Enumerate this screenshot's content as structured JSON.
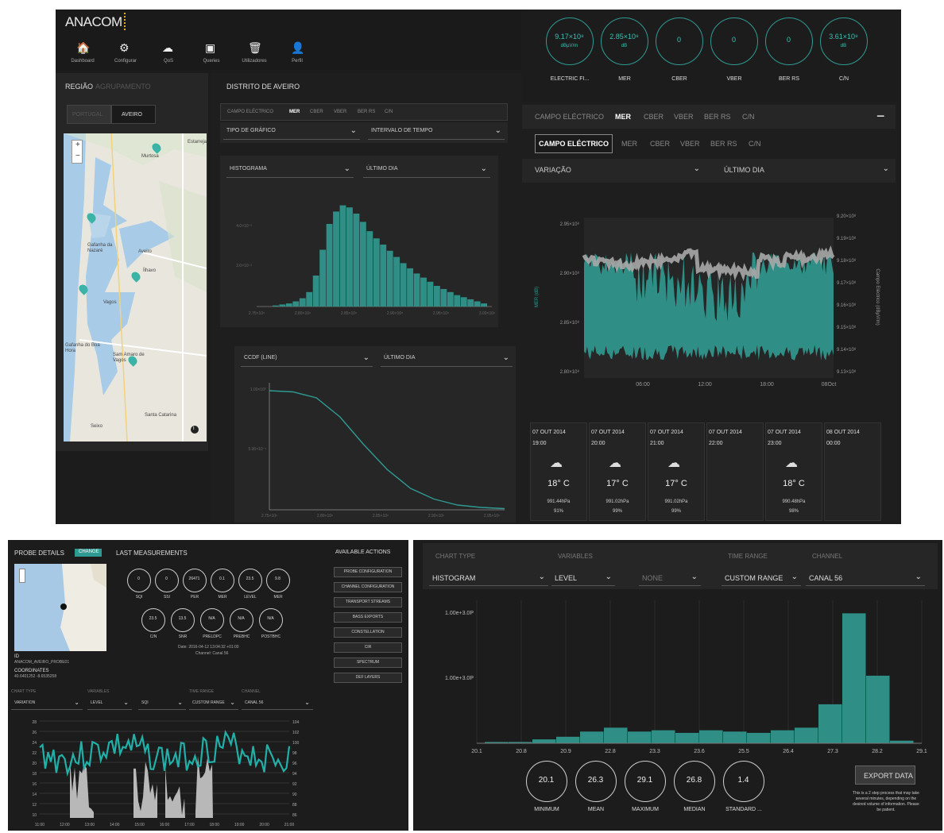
{
  "brand": "ANACOM",
  "nav": [
    "Dashboard",
    "Configurar",
    "QoS",
    "Queries",
    "Utilizadores",
    "Perfil"
  ],
  "left": {
    "region_label": "REGIÃO",
    "region_muted": "AGRUPAMENTO",
    "tab_portugal": "PORTUGAL",
    "tab_aveiro": "AVEIRO",
    "map_places": [
      "Estarreja",
      "Murtosa",
      "Gafanha da Nazaré",
      "Aveiro",
      "Ílhavo",
      "Vagos",
      "Santa Catarina",
      "Seixo",
      "Gafanha do Boa Hora",
      "Sam Amaro de Vagos"
    ],
    "zoom_in": "+",
    "zoom_out": "−",
    "info": "i"
  },
  "mid": {
    "title": "DISTRITO DE AVEIRO",
    "tabs": [
      "CAMPO ELÉCTRICO",
      "MER",
      "CBER",
      "VBER",
      "BER RS",
      "C/N"
    ],
    "dd1": "TIPO DE GRÁFICO",
    "dd2": "INTERVALO DE TEMPO",
    "dd3": "HISTOGRAMA",
    "dd4": "ÚLTIMO DIA",
    "dd5": "CCDF (LINE)",
    "dd6": "ÚLTIMO DIA"
  },
  "gauges": [
    {
      "value": "9.17×10⁸",
      "unit": "dBµV/m",
      "label": "ELECTRIC FI..."
    },
    {
      "value": "2.85×10⁸",
      "unit": "dB",
      "label": "MER"
    },
    {
      "value": "0",
      "unit": "",
      "label": "CBER"
    },
    {
      "value": "0",
      "unit": "",
      "label": "VBER"
    },
    {
      "value": "0",
      "unit": "",
      "label": "BER RS"
    },
    {
      "value": "3.61×10⁸",
      "unit": "dB",
      "label": "C/N"
    }
  ],
  "right": {
    "tabs1": [
      "CAMPO ELÉCTRICO",
      "MER",
      "CBER",
      "VBER",
      "BER RS",
      "C/N"
    ],
    "minus": "−",
    "tabs2": [
      "CAMPO ELÉCTRICO",
      "MER",
      "CBER",
      "VBER",
      "BER RS",
      "C/N"
    ],
    "dd1": "VARIAÇÃO",
    "dd2": "ÚLTIMO DIA",
    "y_left": [
      "2.95×10⁸",
      "2.90×10⁸",
      "2.85×10⁸",
      "2.80×10⁸"
    ],
    "y_right": [
      "9.20×10⁸",
      "9.19×10⁸",
      "9.18×10⁸",
      "9.17×10⁸",
      "9.16×10⁸",
      "9.15×10⁸",
      "9.14×10⁸",
      "9.13×10⁸"
    ],
    "x": [
      "06:00",
      "12:00",
      "18:00",
      "08Oct"
    ],
    "y_left_label": "MER (dB)",
    "y_right_label": "Campo Eléctrico (dBµV/m)"
  },
  "weather": [
    {
      "date": "07 OUT 2014",
      "time": "19:00",
      "temp": "18° C",
      "press": "991.44hPa",
      "hum": "91%"
    },
    {
      "date": "07 OUT 2014",
      "time": "20:00",
      "temp": "17° C",
      "press": "991.02hPa",
      "hum": "99%"
    },
    {
      "date": "07 OUT 2014",
      "time": "21:00",
      "temp": "17° C",
      "press": "991.02hPa",
      "hum": "99%"
    },
    {
      "date": "07 OUT 2014",
      "time": "22:00",
      "temp": "",
      "press": "",
      "hum": ""
    },
    {
      "date": "07 OUT 2014",
      "time": "23:00",
      "temp": "18° C",
      "press": "990.48hPa",
      "hum": "98%"
    },
    {
      "date": "08 OUT 2014",
      "time": "00:00",
      "temp": "",
      "press": "",
      "hum": ""
    }
  ],
  "probe": {
    "title": "PROBE DETAILS",
    "change": "CHANGE",
    "last": "LAST MEASUREMENTS",
    "actions_title": "AVAILABLE ACTIONS",
    "meas_row1": [
      {
        "v": "0",
        "l": "SQI"
      },
      {
        "v": "0",
        "l": "SSI"
      },
      {
        "v": "26471",
        "l": "PER"
      },
      {
        "v": "0.1",
        "l": "MER"
      },
      {
        "v": "23.5",
        "l": "LEVEL"
      },
      {
        "v": "9.8",
        "l": "MER"
      }
    ],
    "meas_row2": [
      {
        "v": "23.5",
        "l": "C/N"
      },
      {
        "v": "13.5",
        "l": "SNR"
      },
      {
        "v": "N/A",
        "l": "PRELDPC"
      },
      {
        "v": "N/A",
        "l": "PREBHC"
      },
      {
        "v": "N/A",
        "l": "POSTBHC"
      }
    ],
    "date": "Date: 2016-04-12 13:04:32 +01:00",
    "channel": "Channel: Canal 56",
    "actions": [
      "PROBE CONFIGURATION",
      "CHANNEL CONFIGURATION",
      "TRANSPORT STREAMS",
      "BASS EXPORTS",
      "CONSTELLATION",
      "CIR",
      "SPECTRUM",
      "DEF LAYERS"
    ],
    "id_label": "ID",
    "id_val": "ANACOM_AVEIRO_PROBE01",
    "coord_label": "COORDINATES",
    "coord_val": "40.6401252 -8.6535258",
    "hdr": [
      "CHART TYPE",
      "VARIABLES",
      "",
      "TIME RANGE",
      "CHANNEL"
    ],
    "dd": [
      "VARIATION",
      "LEVEL",
      "SQI",
      "CUSTOM RANGE",
      "CANAL 56"
    ],
    "yl": [
      "28",
      "26",
      "24",
      "22",
      "20",
      "18",
      "16",
      "14",
      "12",
      "10"
    ],
    "yr": [
      "104",
      "102",
      "100",
      "98",
      "96",
      "94",
      "92",
      "90",
      "88",
      "86"
    ],
    "x": [
      "11:00",
      "12:00",
      "13:00",
      "14:00",
      "15:00",
      "16:00",
      "17:00",
      "18:00",
      "19:00",
      "20:00",
      "21:00"
    ]
  },
  "hist2": {
    "hdr": [
      "CHART TYPE",
      "VARIABLES",
      "",
      "TIME RANGE",
      "CHANNEL"
    ],
    "dd": [
      "HISTOGRAM",
      "LEVEL",
      "NONE",
      "CUSTOM RANGE",
      "CANAL 56"
    ],
    "y": [
      "1.00e+3.0P",
      "1.00e+3.0P"
    ],
    "x": [
      "20.1",
      "20.8",
      "20.9",
      "22.8",
      "23.3",
      "23.6",
      "25.5",
      "26.4",
      "27.3",
      "28.2",
      "29.1"
    ],
    "stats": [
      {
        "v": "20.1",
        "l": "MINIMUM"
      },
      {
        "v": "26.3",
        "l": "MEAN"
      },
      {
        "v": "29.1",
        "l": "MAXIMUM"
      },
      {
        "v": "26.8",
        "l": "MEDIAN"
      },
      {
        "v": "1.4",
        "l": "STANDARD ..."
      }
    ],
    "export": "EXPORT DATA",
    "note": "This is a 2 step process that may take several minutes, depending on the desired volume of information. Please be patient."
  },
  "chart_data": [
    {
      "type": "bar",
      "title": "",
      "values": [
        1,
        2,
        3,
        5,
        8,
        14,
        30,
        55,
        80,
        92,
        98,
        96,
        90,
        82,
        73,
        66,
        60,
        54,
        48,
        42,
        37,
        32,
        28,
        24,
        20,
        17,
        14,
        11,
        9,
        7,
        5,
        3
      ],
      "xlabel": "",
      "ylabel": ""
    },
    {
      "type": "line",
      "title": "CCDF",
      "x": [
        0,
        0.1,
        0.2,
        0.3,
        0.4,
        0.5,
        0.6,
        0.7,
        0.8,
        0.9,
        1
      ],
      "values": [
        1,
        0.99,
        0.94,
        0.78,
        0.55,
        0.34,
        0.18,
        0.09,
        0.04,
        0.02,
        0.01
      ]
    },
    {
      "type": "bar",
      "title": "",
      "categories": [
        "20.1",
        "20.8",
        "20.9",
        "22.8",
        "23.3",
        "23.6",
        "25.5",
        "26.4",
        "27.3",
        "28.2"
      ],
      "values": [
        1,
        1,
        3,
        5,
        9,
        12,
        9,
        10,
        8,
        10,
        9,
        8,
        10,
        12,
        30,
        100,
        52,
        2
      ],
      "ylim": [
        0,
        110
      ]
    }
  ]
}
